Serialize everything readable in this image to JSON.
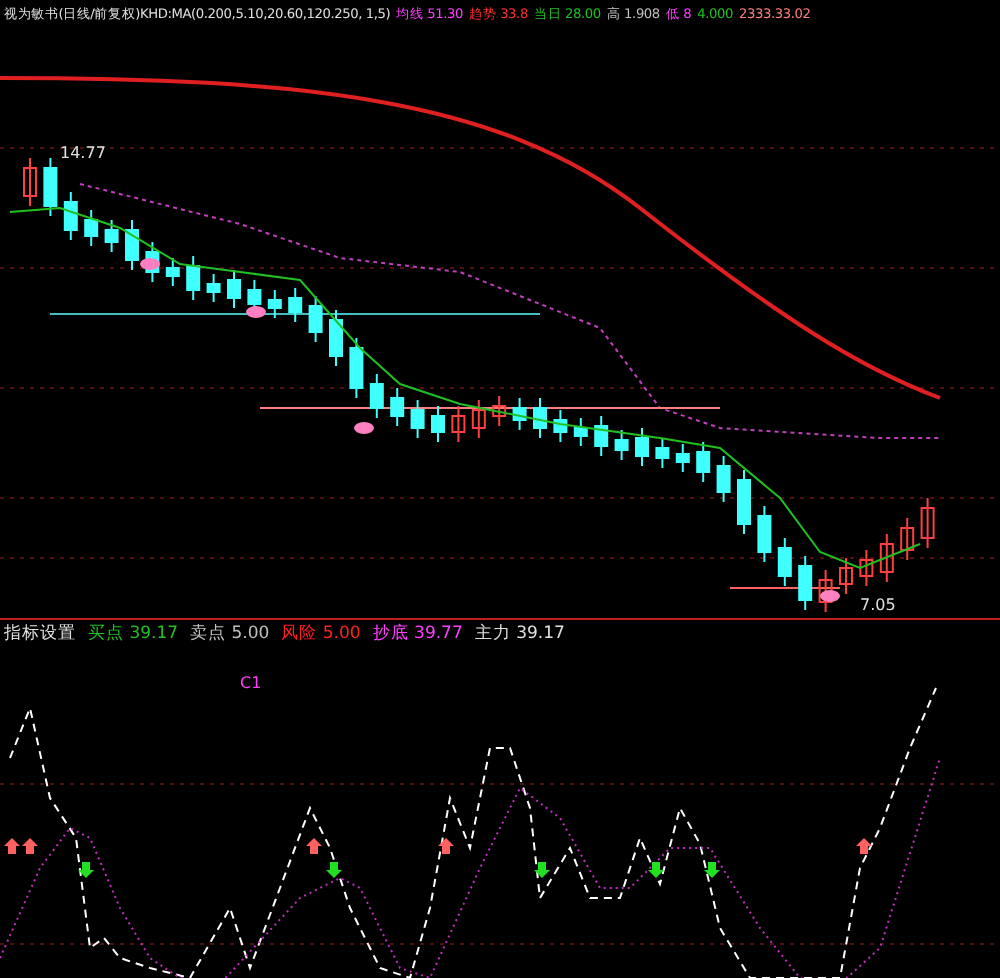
{
  "header": {
    "title": "视为敏书(日线/前复权)KHD:MA(0.200,5.10,20.60,120.250, 1,5)",
    "readings": [
      {
        "label": "均线",
        "value": "51.30",
        "color": "#ff40ff"
      },
      {
        "label": "趋势",
        "value": "33.8",
        "color": "#ff3030"
      },
      {
        "label": "当日",
        "value": "28.00",
        "color": "#20c020"
      },
      {
        "label": "高",
        "value": "1.908",
        "color": "#c0c0c0"
      },
      {
        "label": "低",
        "value": "8",
        "color": "#ff40ff"
      },
      {
        "value": "4.000",
        "color": "#20c020"
      },
      {
        "value": "2333.33.02",
        "color": "#ff8080"
      }
    ]
  },
  "price_panel": {
    "high_label": "14.77",
    "low_label": "7.05"
  },
  "indicator_panel": {
    "title": "指标设置",
    "readings": [
      {
        "label": "买点",
        "value": "39.17",
        "color": "#20c020"
      },
      {
        "label": "卖点",
        "value": "5.00",
        "color": "#c0c0c0"
      },
      {
        "label": "风险",
        "value": "5.00",
        "color": "#ff2020"
      },
      {
        "label": "抄底",
        "value": "39.77",
        "color": "#ff40ff"
      },
      {
        "label": "主力",
        "value": "39.17",
        "color": "#e0e0e0"
      }
    ],
    "level_label": "C1"
  }
}
